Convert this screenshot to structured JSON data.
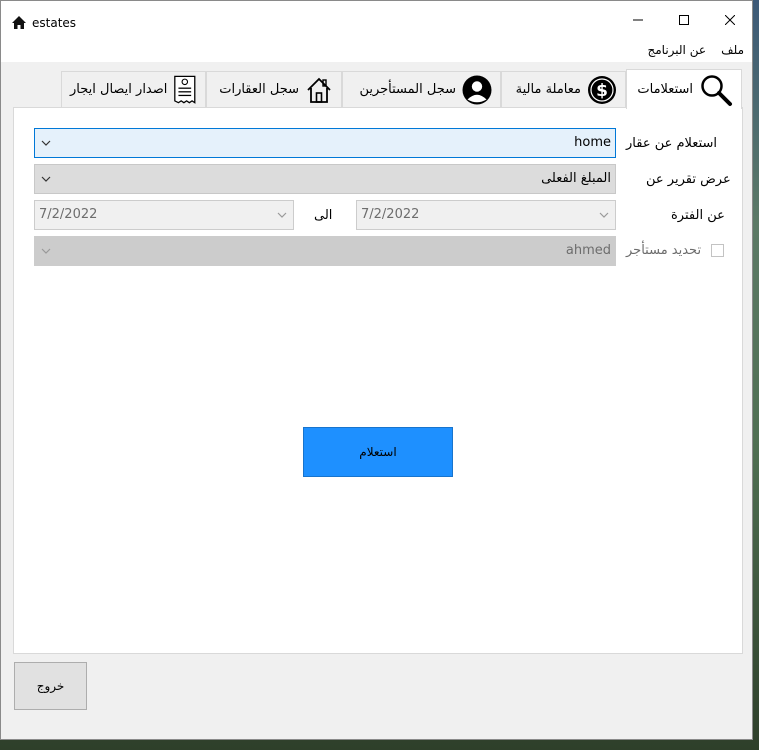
{
  "window": {
    "title": "estates"
  },
  "menu": {
    "file": "ملف",
    "about": "عن البرنامج"
  },
  "tabs": [
    {
      "label": "استعلامات",
      "icon": "search-icon",
      "active": true
    },
    {
      "label": "معاملة مالية",
      "icon": "dollar-icon",
      "active": false
    },
    {
      "label": "سجل المستأجرين",
      "icon": "user-icon",
      "active": false
    },
    {
      "label": "سجل العقارات",
      "icon": "house-icon",
      "active": false
    },
    {
      "label": "اصدار ايصال ايجار",
      "icon": "receipt-icon",
      "active": false
    }
  ],
  "form": {
    "property_label": "استعلام عن عقار",
    "property_value": "home",
    "report_label": "عرض تقرير عن",
    "report_value": "المبلغ الفعلى",
    "period_label": "عن الفترة",
    "period_from": "7/2/2022",
    "to_label": "الى",
    "period_to": "7/2/2022",
    "tenant_checkbox_label": "تحديد مستأجر",
    "tenant_value": "ahmed"
  },
  "buttons": {
    "inquiry": "استعلام",
    "exit": "خروج"
  },
  "colors": {
    "accent": "#1e90ff",
    "focus_border": "#0078d7"
  }
}
